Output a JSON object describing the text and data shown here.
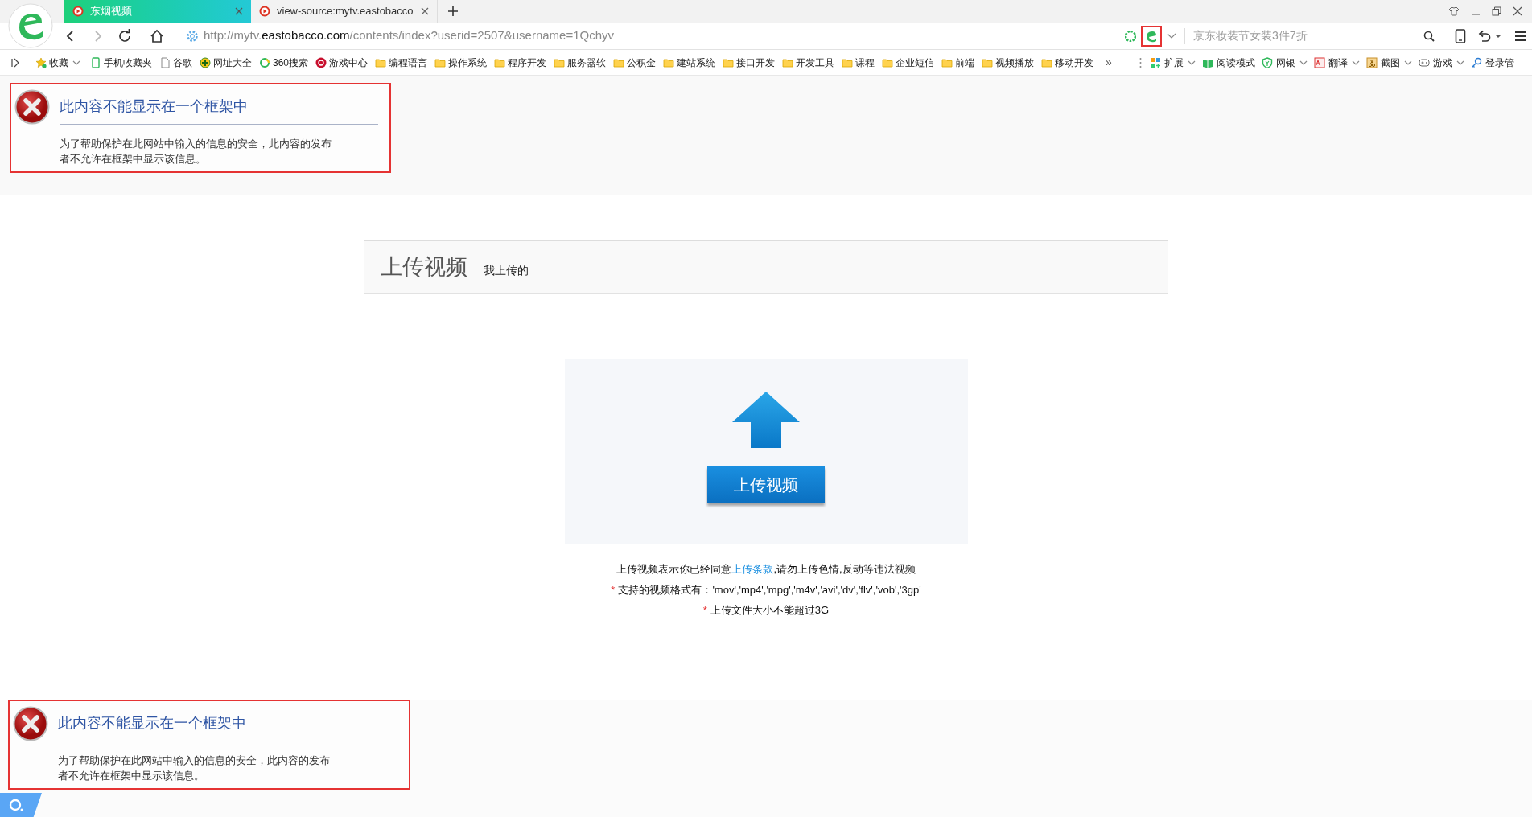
{
  "browser": {
    "tabs": [
      {
        "title": "东烟视频",
        "selected": true
      },
      {
        "title": "view-source:mytv.eastobacco.",
        "selected": false
      }
    ],
    "address": {
      "scheme": "http://mytv.",
      "domain": "eastobacco.com",
      "path": "/contents/index?userid=2507&username=1Qchyv"
    },
    "search": {
      "placeholder": "京东妆装节女装3件7折"
    },
    "bookmarks": [
      {
        "kind": "star",
        "label": "收藏"
      },
      {
        "kind": "phone",
        "label": "手机收藏夹"
      },
      {
        "kind": "page",
        "label": "谷歌"
      },
      {
        "kind": "nav",
        "label": "网址大全"
      },
      {
        "kind": "ring",
        "label": "360搜索"
      },
      {
        "kind": "game",
        "label": "游戏中心"
      },
      {
        "kind": "folder",
        "label": "编程语言"
      },
      {
        "kind": "folder",
        "label": "操作系统"
      },
      {
        "kind": "folder",
        "label": "程序开发"
      },
      {
        "kind": "folder",
        "label": "服务器软"
      },
      {
        "kind": "folder",
        "label": "公积金"
      },
      {
        "kind": "folder",
        "label": "建站系统"
      },
      {
        "kind": "folder",
        "label": "接口开发"
      },
      {
        "kind": "folder",
        "label": "开发工具"
      },
      {
        "kind": "folder",
        "label": "课程"
      },
      {
        "kind": "folder",
        "label": "企业短信"
      },
      {
        "kind": "folder",
        "label": "前端"
      },
      {
        "kind": "folder",
        "label": "视频播放"
      },
      {
        "kind": "folder",
        "label": "移动开发"
      }
    ],
    "more_bookmarks": "»",
    "tools": [
      {
        "label": "扩展",
        "menu": true
      },
      {
        "label": "阅读模式",
        "menu": false
      },
      {
        "label": "网银",
        "menu": true
      },
      {
        "label": "翻译",
        "menu": true
      },
      {
        "label": "截图",
        "menu": true
      },
      {
        "label": "游戏",
        "menu": true
      },
      {
        "label": "登录管",
        "menu": false
      }
    ]
  },
  "frame_errors": [
    {
      "title": "此内容不能显示在一个框架中",
      "message": "为了帮助保护在此网站中输入的信息的安全，此内容的发布者不允许在框架中显示该信息。"
    },
    {
      "title": "此内容不能显示在一个框架中",
      "message": "为了帮助保护在此网站中输入的信息的安全，此内容的发布者不允许在框架中显示该信息。"
    }
  ],
  "upload_panel": {
    "title": "上传视频",
    "tab": "我上传的",
    "button": "上传视频",
    "notice_before": "上传视频表示你已经同意",
    "notice_link": "上传条款",
    "notice_after": ",请勿上传色情,反动等违法视频",
    "rules": [
      "支持的视频格式有：'mov','mp4','mpg','m4v','avi','dv','flv','vob','3gp'",
      "上传文件大小不能超过3G"
    ],
    "rule_mark": "*"
  }
}
